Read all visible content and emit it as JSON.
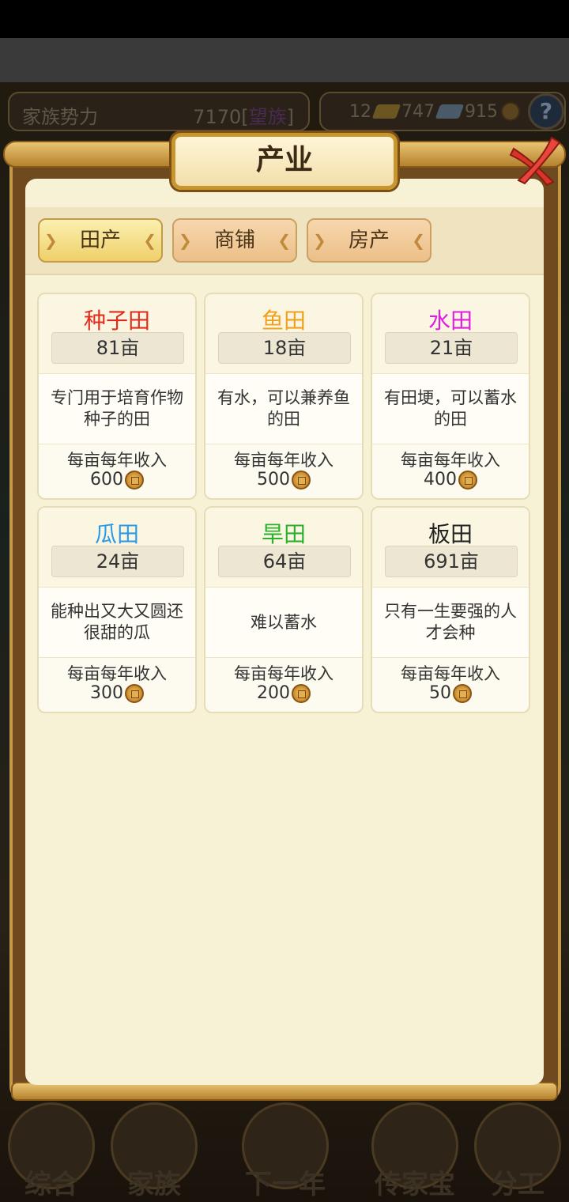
{
  "hud": {
    "power_label": "家族势力",
    "power_value": "7170",
    "power_tier": "望族",
    "res_value_1": "12",
    "res_value_2": "747",
    "res_value_3": "915",
    "help_glyph": "?"
  },
  "modal": {
    "title": "产业",
    "tabs": [
      {
        "label": "田产",
        "active": true
      },
      {
        "label": "商铺",
        "active": false
      },
      {
        "label": "房产",
        "active": false
      }
    ],
    "income_label": "每亩每年收入",
    "fields": [
      {
        "name": "种子田",
        "color": "#e02c1c",
        "area": "81亩",
        "desc": "专门用于培育作物种子的田",
        "income": "600"
      },
      {
        "name": "鱼田",
        "color": "#f0a020",
        "area": "18亩",
        "desc": "有水，可以兼养鱼的田",
        "income": "500"
      },
      {
        "name": "水田",
        "color": "#e01ce0",
        "area": "21亩",
        "desc": "有田埂，可以蓄水的田",
        "income": "400"
      },
      {
        "name": "瓜田",
        "color": "#2a9ae8",
        "area": "24亩",
        "desc": "能种出又大又圆还很甜的瓜",
        "income": "300"
      },
      {
        "name": "旱田",
        "color": "#2ab02a",
        "area": "64亩",
        "desc": "难以蓄水",
        "income": "200"
      },
      {
        "name": "板田",
        "color": "#222222",
        "area": "691亩",
        "desc": "只有一生要强的人才会种",
        "income": "50"
      }
    ]
  },
  "bottom_nav": [
    {
      "label": "综合"
    },
    {
      "label": "家族"
    },
    {
      "label": "下一年"
    },
    {
      "label": "传家宝"
    },
    {
      "label": "分工"
    }
  ]
}
